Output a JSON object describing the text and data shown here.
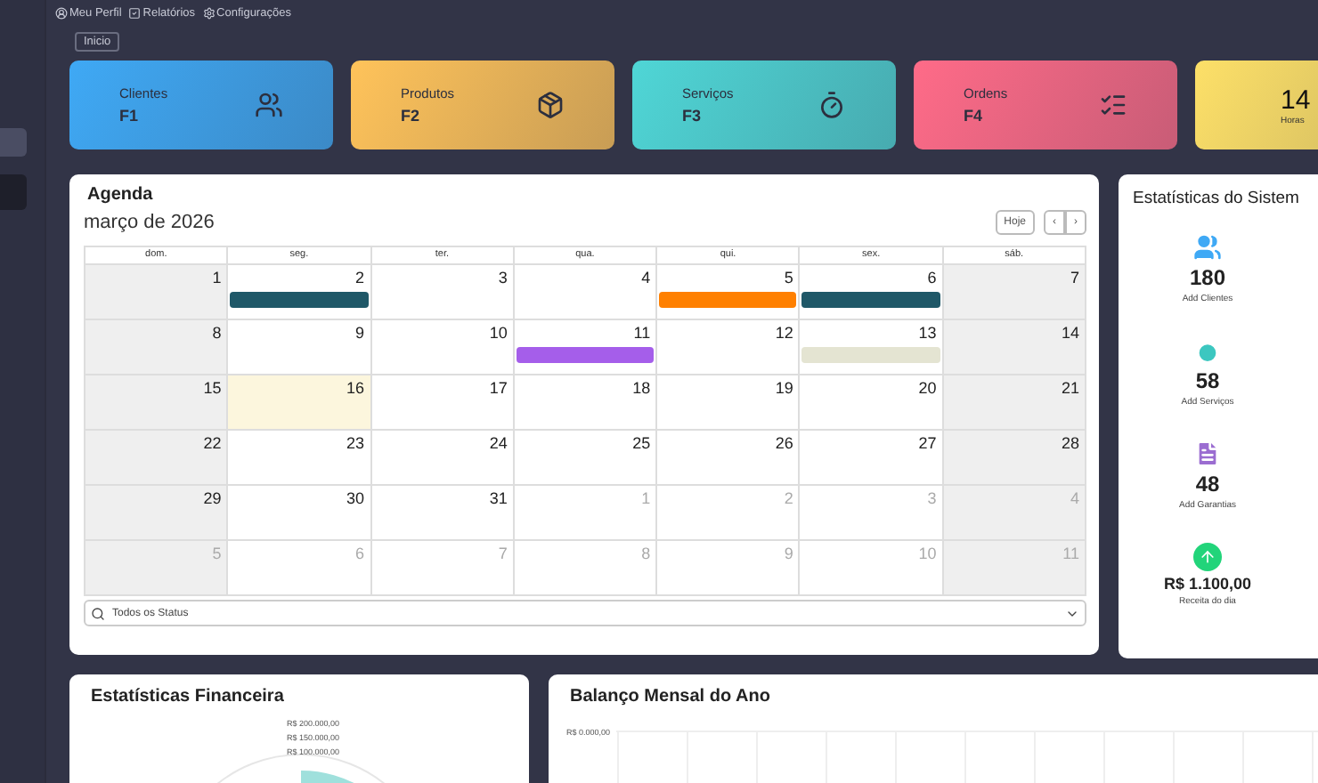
{
  "nav_links": [
    {
      "label": "Meu Perfil",
      "kind": "profile"
    },
    {
      "label": "Relatórios",
      "kind": "report"
    },
    {
      "label": "Configurações",
      "kind": "settings"
    }
  ],
  "sidebar": {
    "items": [
      {
        "selected": true
      },
      {
        "selected": false
      }
    ]
  },
  "breadcrumb": "Inicio",
  "shortcut_cards": [
    {
      "title": "Clientes",
      "key": "F1",
      "kind": "clients",
      "color": "#3fa9f5"
    },
    {
      "title": "Produtos",
      "key": "F2",
      "kind": "products",
      "color": "#ffc35a"
    },
    {
      "title": "Serviços",
      "key": "F3",
      "kind": "services",
      "color": "#4fd6d6"
    },
    {
      "title": "Ordens",
      "key": "F4",
      "kind": "orders",
      "color": "#ff6b88"
    },
    {
      "title": "14",
      "key": "Horas",
      "kind": "hours",
      "color": "#fde068"
    }
  ],
  "agenda": {
    "title": "Agenda",
    "month": "março de 2026",
    "today_button": "Hoje",
    "prev": "‹",
    "next": "›",
    "weekdays": [
      "dom.",
      "seg.",
      "ter.",
      "qua.",
      "qui.",
      "sex.",
      "sáb."
    ],
    "weeks": [
      [
        {
          "day": "1",
          "other_month": false,
          "today": false
        },
        {
          "day": "2",
          "other_month": false,
          "today": false,
          "events": [
            {
              "color": "#1f5868"
            }
          ]
        },
        {
          "day": "3",
          "other_month": false,
          "today": false
        },
        {
          "day": "4",
          "other_month": false,
          "today": false
        },
        {
          "day": "5",
          "other_month": false,
          "today": false,
          "events": [
            {
              "color": "#ff8000"
            }
          ]
        },
        {
          "day": "6",
          "other_month": false,
          "today": false,
          "events": [
            {
              "color": "#1f5868"
            }
          ]
        },
        {
          "day": "7",
          "other_month": false,
          "today": false
        }
      ],
      [
        {
          "day": "8",
          "other_month": false,
          "today": false
        },
        {
          "day": "9",
          "other_month": false,
          "today": false
        },
        {
          "day": "10",
          "other_month": false,
          "today": false
        },
        {
          "day": "11",
          "other_month": false,
          "today": false,
          "events": [
            {
              "color": "#a55eea"
            }
          ]
        },
        {
          "day": "12",
          "other_month": false,
          "today": false
        },
        {
          "day": "13",
          "other_month": false,
          "today": false,
          "events": [
            {
              "color": "#e4e4d2"
            }
          ]
        },
        {
          "day": "14",
          "other_month": false,
          "today": false
        }
      ],
      [
        {
          "day": "15",
          "other_month": false,
          "today": false
        },
        {
          "day": "16",
          "other_month": false,
          "today": true
        },
        {
          "day": "17",
          "other_month": false,
          "today": false
        },
        {
          "day": "18",
          "other_month": false,
          "today": false
        },
        {
          "day": "19",
          "other_month": false,
          "today": false
        },
        {
          "day": "20",
          "other_month": false,
          "today": false
        },
        {
          "day": "21",
          "other_month": false,
          "today": false
        }
      ],
      [
        {
          "day": "22",
          "other_month": false,
          "today": false
        },
        {
          "day": "23",
          "other_month": false,
          "today": false
        },
        {
          "day": "24",
          "other_month": false,
          "today": false
        },
        {
          "day": "25",
          "other_month": false,
          "today": false
        },
        {
          "day": "26",
          "other_month": false,
          "today": false
        },
        {
          "day": "27",
          "other_month": false,
          "today": false
        },
        {
          "day": "28",
          "other_month": false,
          "today": false
        }
      ],
      [
        {
          "day": "29",
          "other_month": false,
          "today": false
        },
        {
          "day": "30",
          "other_month": false,
          "today": false
        },
        {
          "day": "31",
          "other_month": false,
          "today": false
        },
        {
          "day": "1",
          "other_month": true,
          "today": false
        },
        {
          "day": "2",
          "other_month": true,
          "today": false
        },
        {
          "day": "3",
          "other_month": true,
          "today": false
        },
        {
          "day": "4",
          "other_month": true,
          "today": false
        }
      ],
      [
        {
          "day": "5",
          "other_month": true,
          "today": false
        },
        {
          "day": "6",
          "other_month": true,
          "today": false
        },
        {
          "day": "7",
          "other_month": true,
          "today": false
        },
        {
          "day": "8",
          "other_month": true,
          "today": false
        },
        {
          "day": "9",
          "other_month": true,
          "today": false
        },
        {
          "day": "10",
          "other_month": true,
          "today": false
        },
        {
          "day": "11",
          "other_month": true,
          "today": false
        }
      ]
    ],
    "status_filter": {
      "value": "Todos os Status"
    }
  },
  "system_stats": {
    "title": "Estatísticas do Sistem",
    "items": [
      {
        "value": "180",
        "label": "Add Clientes",
        "kind": "clients",
        "color": "#3fa9f5"
      },
      {
        "value": "58",
        "label": "Add Serviços",
        "kind": "services",
        "color": "#3cc7c0"
      },
      {
        "value": "48",
        "label": "Add Garantias",
        "kind": "warranty",
        "color": "#9b6dd1"
      },
      {
        "value": "R$ 1.100,00",
        "label": "Receita do dia",
        "kind": "revenue",
        "color": "#22d47a"
      }
    ]
  },
  "financial_stats": {
    "title": "Estatísticas Financeira",
    "tick_labels": [
      "R$ 200.000,00",
      "R$ 150.000,00",
      "R$ 100.000,00"
    ]
  },
  "monthly_balance": {
    "title": "Balanço Mensal do Ano",
    "tick_labels": [
      "R$ 0.000,00"
    ]
  }
}
